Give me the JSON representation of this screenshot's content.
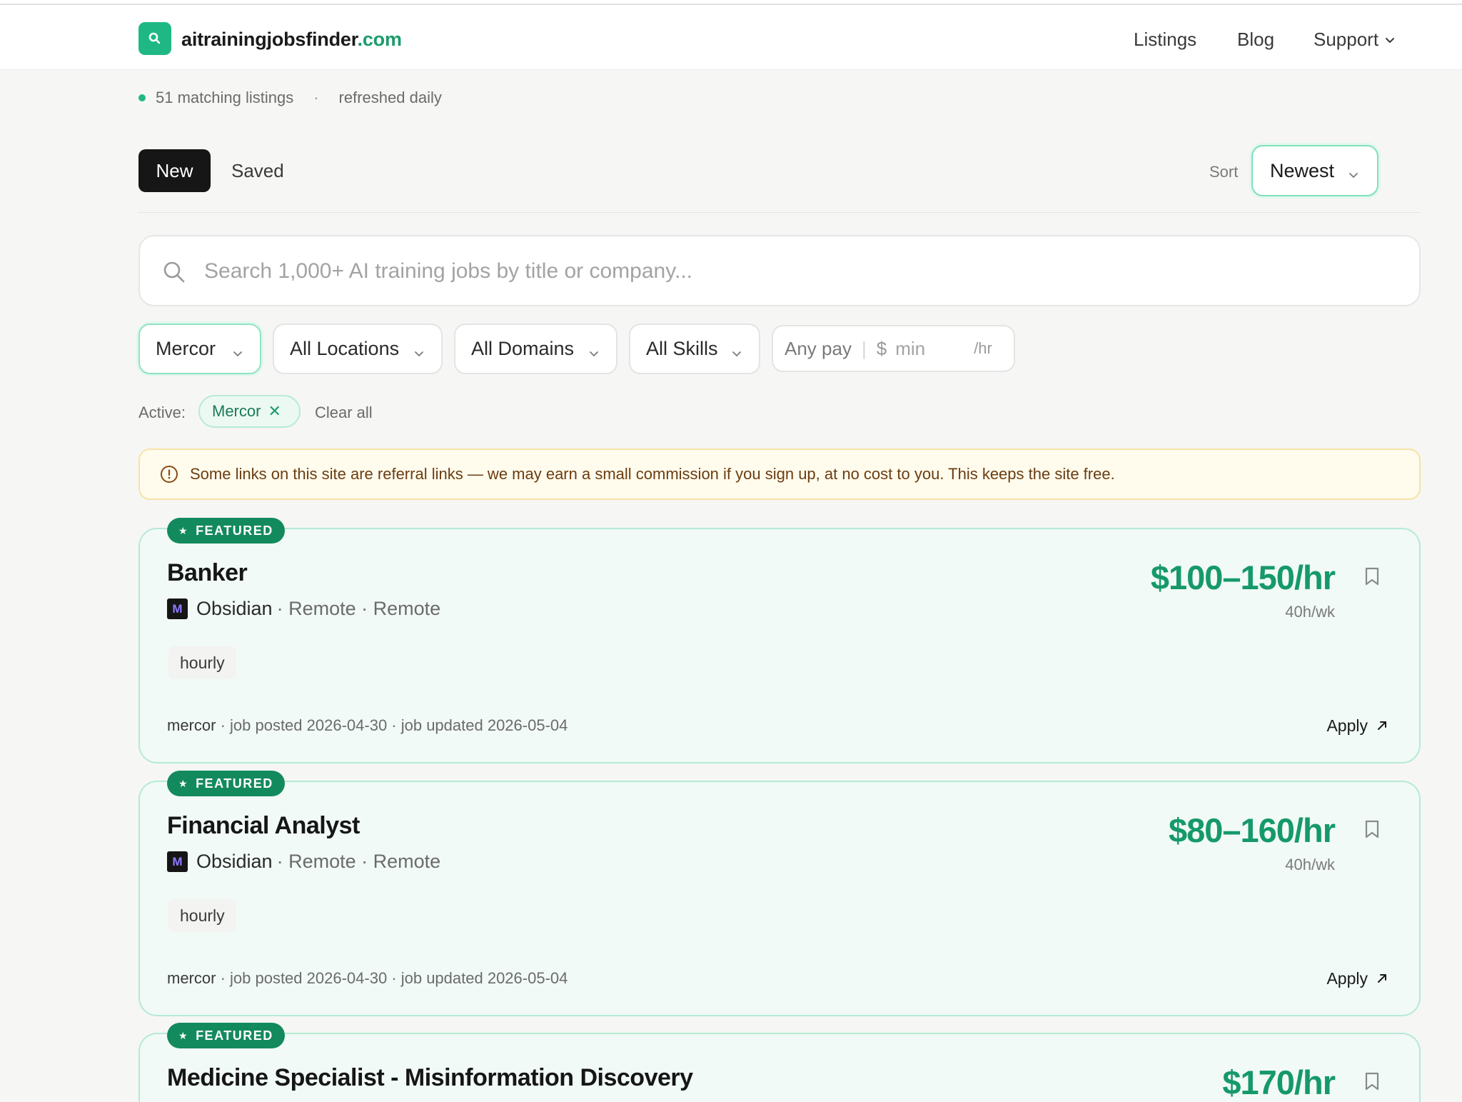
{
  "brand": {
    "name": "aitrainingjobsfinder",
    "tld": ".com",
    "accent": "#1fb884"
  },
  "nav": {
    "listings": "Listings",
    "blog": "Blog",
    "support": "Support"
  },
  "meta": {
    "count": "51 matching listings",
    "sep": "·",
    "refresh": "refreshed daily"
  },
  "tabs": {
    "new": "New",
    "saved": "Saved"
  },
  "sort": {
    "label": "Sort",
    "value": "Newest"
  },
  "search": {
    "placeholder": "Search 1,000+ AI training jobs by title or company..."
  },
  "filters": {
    "company": "Mercor",
    "locations": "All Locations",
    "domains": "All Domains",
    "skills": "All Skills",
    "pay": {
      "label": "Any pay",
      "currency": "$",
      "min_placeholder": "min",
      "unit": "/hr"
    }
  },
  "active": {
    "label": "Active:",
    "chip": "Mercor",
    "clear": "Clear all"
  },
  "notice": {
    "text": "Some links on this site are referral links — we may earn a small commission if you sign up, at no cost to you. This keeps the site free."
  },
  "jobs": [
    {
      "badge": "FEATURED",
      "title": "Banker",
      "company": "Obsidian",
      "location": "· Remote · Remote",
      "tag": "hourly",
      "pay": "$100–150/hr",
      "hours": "40h/wk",
      "source": "mercor",
      "dates": " · job posted 2026-04-30 · job updated 2026-05-04",
      "apply": "Apply"
    },
    {
      "badge": "FEATURED",
      "title": "Financial Analyst",
      "company": "Obsidian",
      "location": "· Remote · Remote",
      "tag": "hourly",
      "pay": "$80–160/hr",
      "hours": "40h/wk",
      "source": "mercor",
      "dates": " · job posted 2026-04-30 · job updated 2026-05-04",
      "apply": "Apply"
    },
    {
      "badge": "FEATURED",
      "title": "Medicine Specialist - Misinformation Discovery",
      "pay": "$170/hr"
    }
  ]
}
